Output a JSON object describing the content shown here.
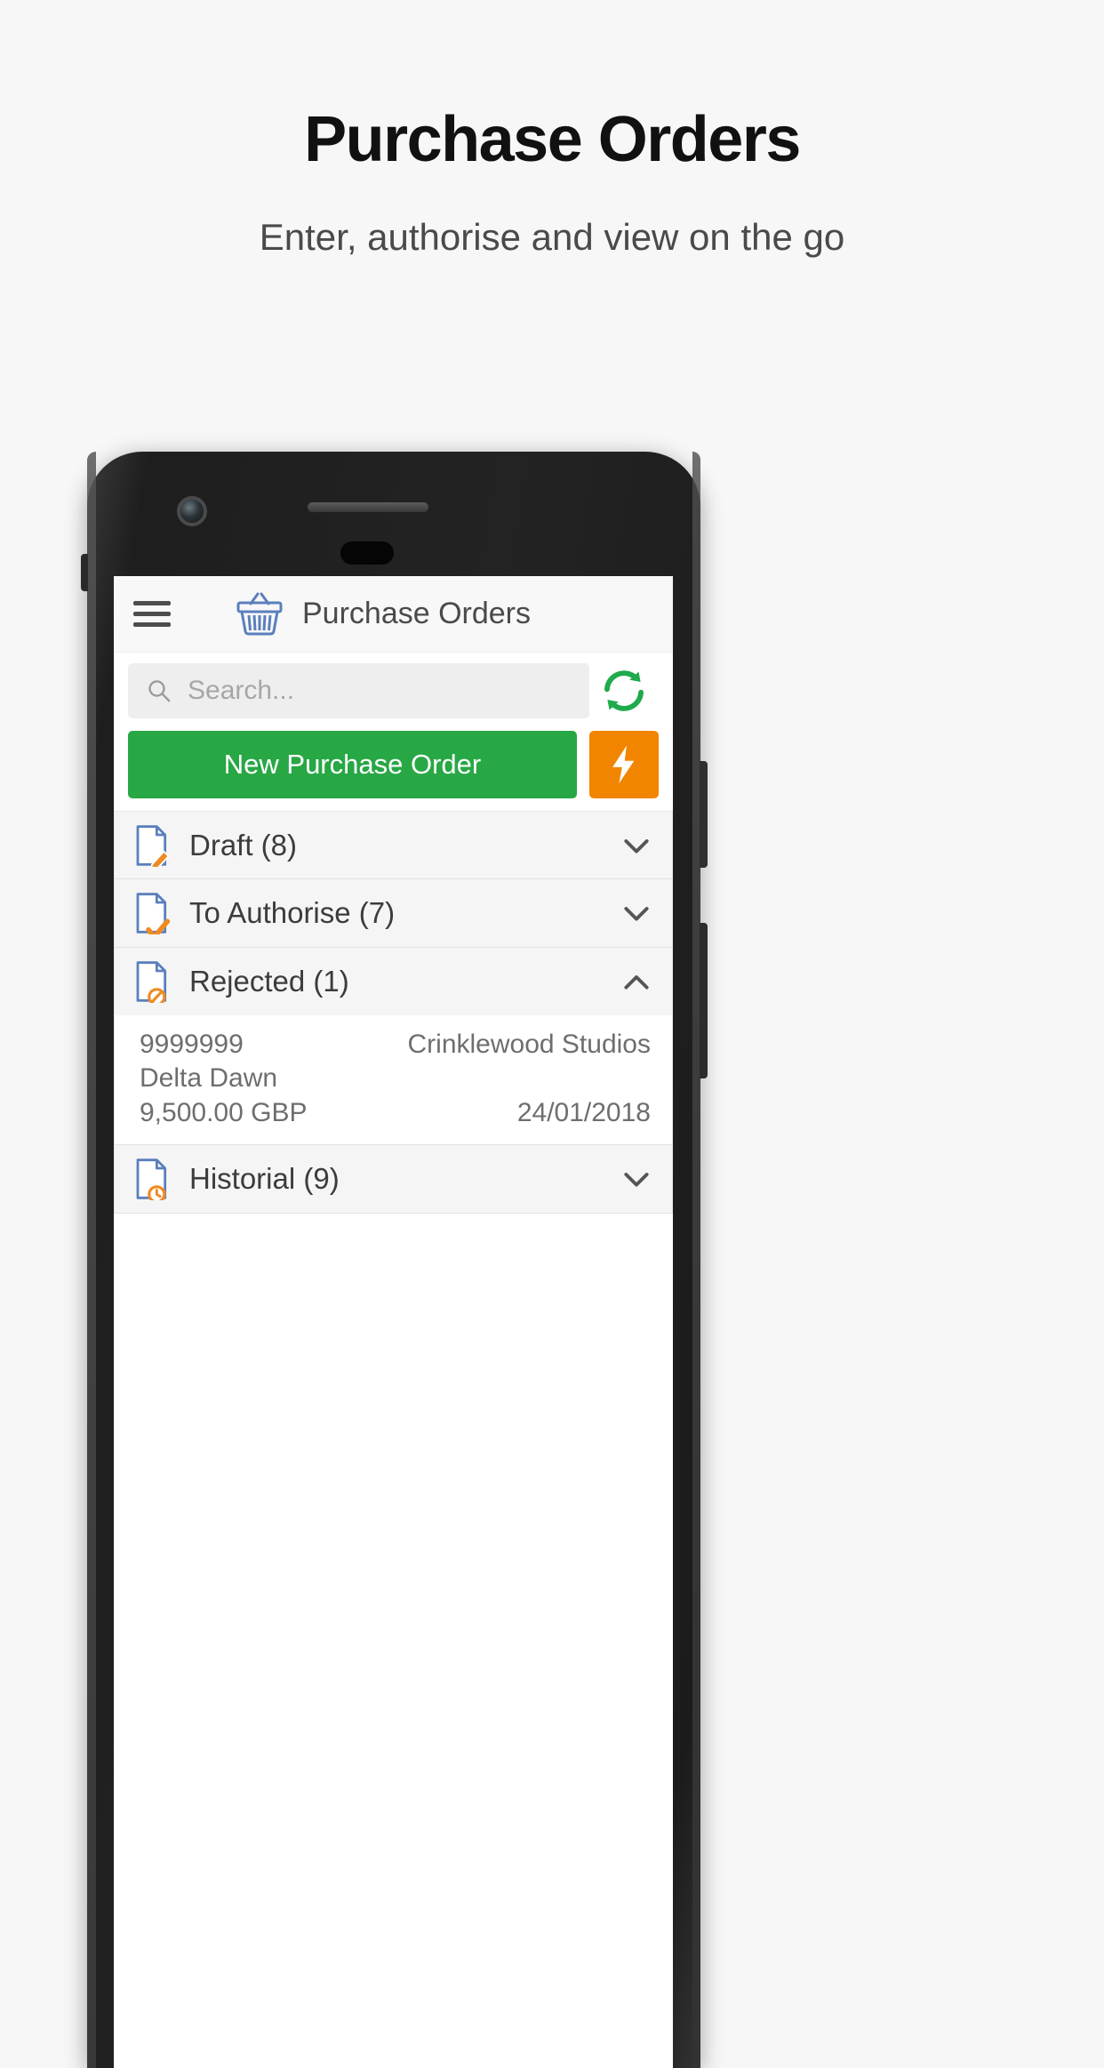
{
  "promo": {
    "headline": "Purchase Orders",
    "subtitle": "Enter, authorise and view on the go"
  },
  "colors": {
    "page_background": "#f7f7f7",
    "headline": "#111111",
    "subtitle": "#4a4a4a",
    "primary_green": "#28a745",
    "accent_orange": "#f28500",
    "icon_blue": "#5b7fbd",
    "refresh_green": "#1faa4b"
  },
  "app": {
    "appbar": {
      "menu_icon": "hamburger-menu-icon",
      "brand_icon": "shopping-basket-icon",
      "title": "Purchase Orders"
    },
    "search": {
      "icon": "search-icon",
      "placeholder": "Search...",
      "value": "",
      "refresh_icon": "refresh-icon"
    },
    "actions": {
      "new_order_label": "New Purchase Order",
      "quick_action_icon": "lightning-bolt-icon"
    },
    "sections": [
      {
        "id": "draft",
        "label": "Draft (8)",
        "icon": "document-pencil-icon",
        "expanded": false,
        "chevron": "chevron-down-icon"
      },
      {
        "id": "to-authorise",
        "label": "To Authorise (7)",
        "icon": "document-check-icon",
        "expanded": false,
        "chevron": "chevron-down-icon"
      },
      {
        "id": "rejected",
        "label": "Rejected (1)",
        "icon": "document-blocked-icon",
        "expanded": true,
        "chevron": "chevron-up-icon",
        "orders": [
          {
            "number": "9999999",
            "supplier": "Crinklewood Studios",
            "description": "Delta Dawn",
            "amount": "9,500.00 GBP",
            "date": "24/01/2018"
          }
        ]
      },
      {
        "id": "historial",
        "label": "Historial (9)",
        "icon": "document-clock-icon",
        "expanded": false,
        "chevron": "chevron-down-icon"
      }
    ]
  }
}
